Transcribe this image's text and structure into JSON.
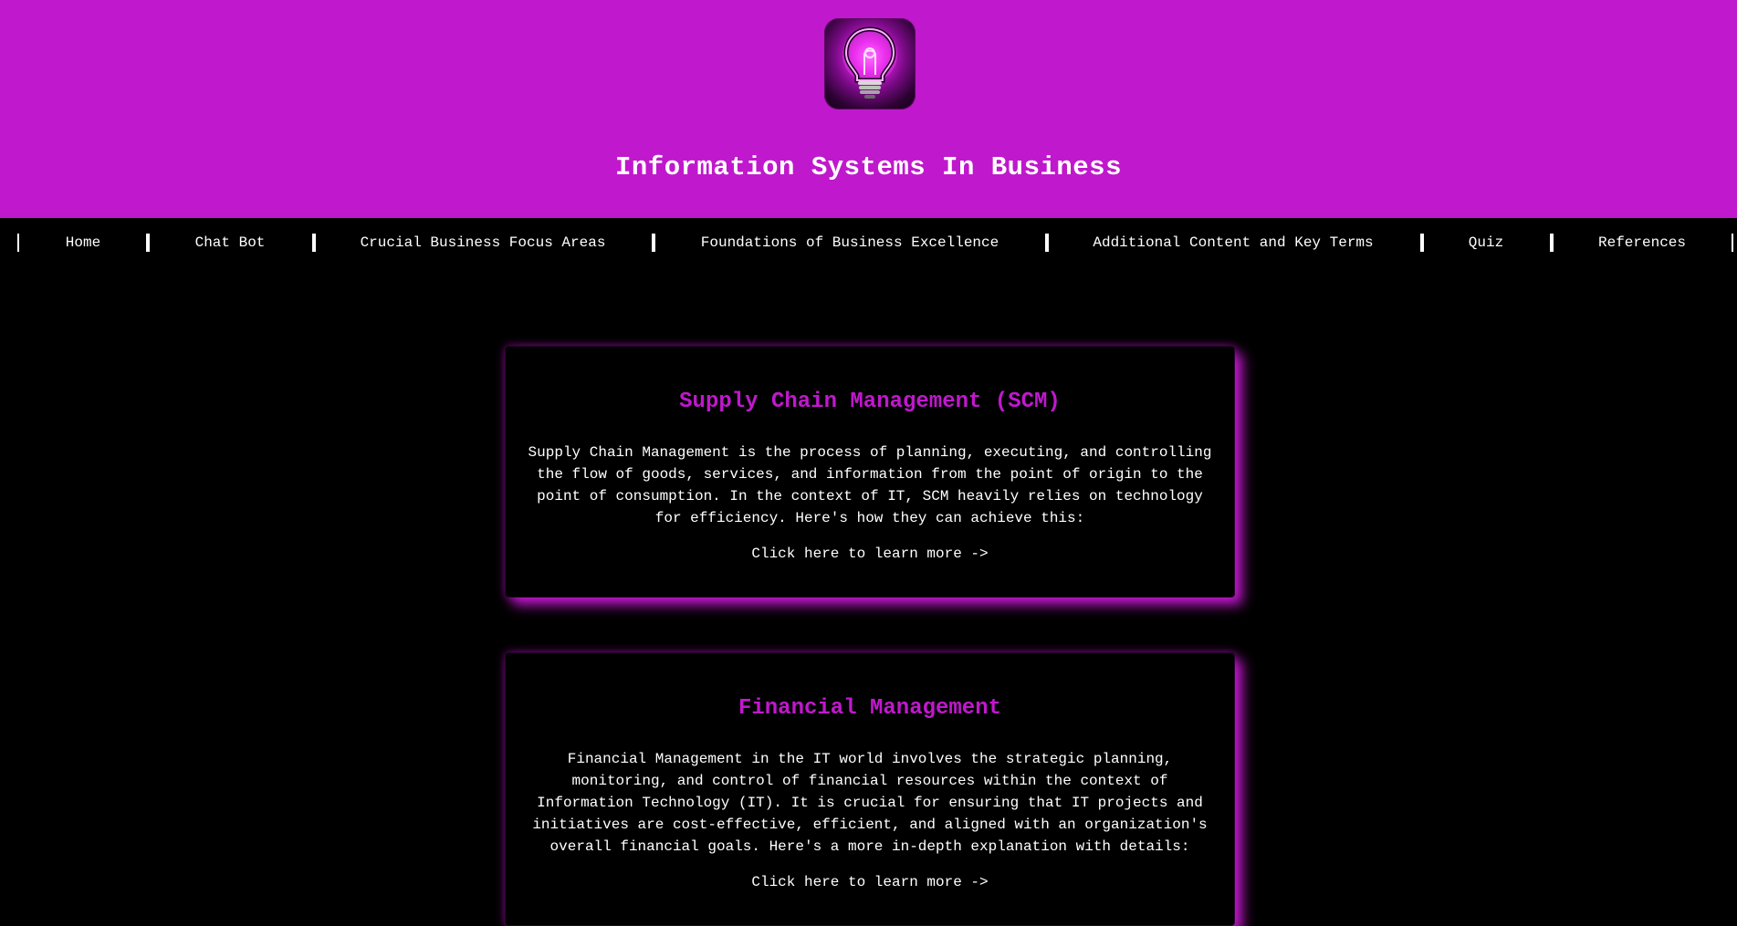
{
  "header": {
    "logo_icon": "lightbulb-icon",
    "title": "Information Systems In Business",
    "background": "#c018cc"
  },
  "nav": {
    "items": [
      {
        "label": "Home"
      },
      {
        "label": "Chat Bot"
      },
      {
        "label": "Crucial Business Focus Areas"
      },
      {
        "label": "Foundations of Business Excellence"
      },
      {
        "label": "Additional Content and Key Terms"
      },
      {
        "label": "Quiz"
      },
      {
        "label": "References"
      }
    ]
  },
  "cards": [
    {
      "title": "Supply Chain Management (SCM)",
      "text": "Supply Chain Management is the process of planning, executing, and controlling the flow of goods, services, and information from the point of origin to the point of consumption. In the context of IT, SCM heavily relies on technology for efficiency. Here's how they can achieve this:",
      "link": "Click here to learn more ->"
    },
    {
      "title": "Financial Management",
      "text": "Financial Management in the IT world involves the strategic planning, monitoring, and control of financial resources within the context of Information Technology (IT). It is crucial for ensuring that IT projects and initiatives are cost-effective, efficient, and aligned with an organization's overall financial goals. Here's a more in-depth explanation with details:",
      "link": "Click here to learn more ->"
    }
  ],
  "colors": {
    "accent": "#c018cc",
    "background": "#000000",
    "text": "#ffffff"
  }
}
